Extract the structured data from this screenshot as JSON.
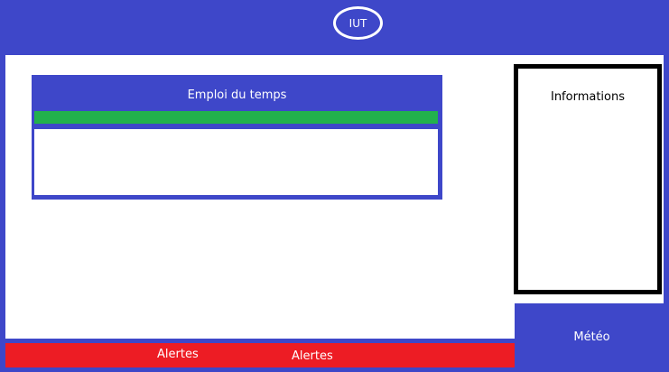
{
  "header": {
    "logo_text": "IUT"
  },
  "schedule": {
    "title": "Emploi du temps"
  },
  "info_panel": {
    "title": "Informations"
  },
  "weather": {
    "label": "Météo"
  },
  "alerts": {
    "items": [
      "Alertes",
      "Alertes"
    ]
  },
  "colors": {
    "background": "#3e47c9",
    "content": "#ffffff",
    "schedule_bar": "#22b14c",
    "alert_bar": "#ed1c24",
    "info_border": "#000000"
  }
}
